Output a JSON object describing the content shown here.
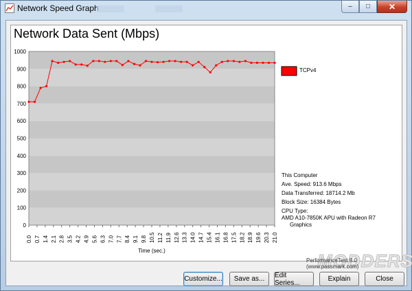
{
  "window": {
    "title": "Network Speed Graph",
    "buttons": {
      "minimize": "–",
      "maximize": "□",
      "close": "✕"
    }
  },
  "graph": {
    "title": "Network Data Sent (Mbps)",
    "legend": {
      "label": "TCPv4",
      "color": "#ff0000"
    },
    "info": {
      "computer": "This Computer",
      "ave_speed": "Ave. Speed: 913.6 Mbps",
      "data_transferred": "Data Transferred: 18714.2 Mb",
      "block_size": "Block Size: 16384 Bytes",
      "cpu_type_label": "CPU Type:",
      "cpu_line1": "AMD A10-7850K APU with Radeon R7",
      "cpu_line2": "Graphics"
    },
    "credit": "PerformanceTest 8.0 (www.passmark.com)",
    "watermark": "MODDERS"
  },
  "chart_data": {
    "type": "line",
    "xlabel": "Time (sec.)",
    "ylabel": "",
    "xlim": [
      0,
      21
    ],
    "ylim": [
      0,
      1000
    ],
    "x_ticks": [
      "0.0",
      "0.7",
      "1.4",
      "2.1",
      "2.8",
      "3.5",
      "4.2",
      "4.9",
      "5.6",
      "6.3",
      "7.0",
      "7.7",
      "8.4",
      "9.1",
      "9.8",
      "10.5",
      "11.2",
      "11.9",
      "12.6",
      "13.3",
      "14.0",
      "14.7",
      "15.4",
      "16.1",
      "16.8",
      "17.5",
      "18.2",
      "18.9",
      "19.6",
      "20.3",
      "21.0"
    ],
    "y_ticks": [
      0,
      100,
      200,
      300,
      400,
      500,
      600,
      700,
      800,
      900,
      1000
    ],
    "grid": true,
    "series": [
      {
        "name": "TCPv4",
        "color": "#ff0000",
        "x": [
          0.0,
          0.5,
          1.0,
          1.5,
          2.0,
          2.5,
          3.0,
          3.5,
          4.0,
          4.5,
          5.0,
          5.5,
          6.0,
          6.5,
          7.0,
          7.5,
          8.0,
          8.5,
          9.0,
          9.5,
          10.0,
          10.5,
          11.0,
          11.5,
          12.0,
          12.5,
          13.0,
          13.5,
          14.0,
          14.5,
          15.0,
          15.5,
          16.0,
          16.5,
          17.0,
          17.5,
          18.0,
          18.5,
          19.0,
          19.5,
          20.0,
          20.5,
          21.0
        ],
        "values": [
          710,
          710,
          790,
          800,
          945,
          935,
          940,
          945,
          925,
          925,
          918,
          945,
          945,
          940,
          945,
          945,
          922,
          945,
          928,
          920,
          945,
          940,
          938,
          940,
          945,
          945,
          940,
          940,
          920,
          940,
          910,
          880,
          920,
          940,
          945,
          945,
          940,
          945,
          935,
          935,
          935,
          935,
          935
        ]
      }
    ]
  },
  "buttons": {
    "customize": "Customize...",
    "save_as": "Save as...",
    "edit_series": "Edit Series...",
    "explain": "Explain",
    "close": "Close"
  }
}
